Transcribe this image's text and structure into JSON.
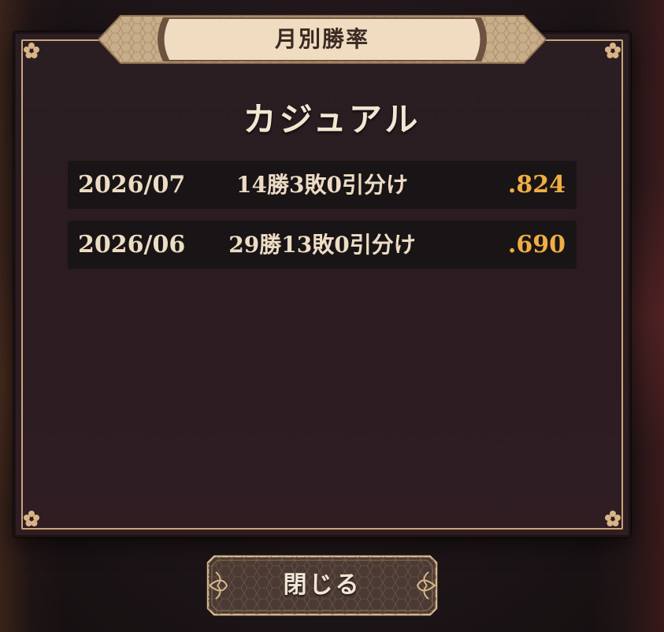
{
  "dialog": {
    "title": "月別勝率",
    "mode": "カジュアル",
    "close_label": "閉じる"
  },
  "records": [
    {
      "month": "2026/07",
      "record": "14勝3敗0引分け",
      "rate": ".824"
    },
    {
      "month": "2026/06",
      "record": "29勝13敗0引分け",
      "rate": ".690"
    }
  ],
  "colors": {
    "frame_gold": "#c9a57a",
    "rate_orange": "#f0ad44",
    "panel_bg": "#2b1e22",
    "banner_cream": "#f0dcc0"
  },
  "icons": {
    "corner": "cherry-blossom-icon",
    "button_ornament": "sakura-ornament-icon"
  }
}
